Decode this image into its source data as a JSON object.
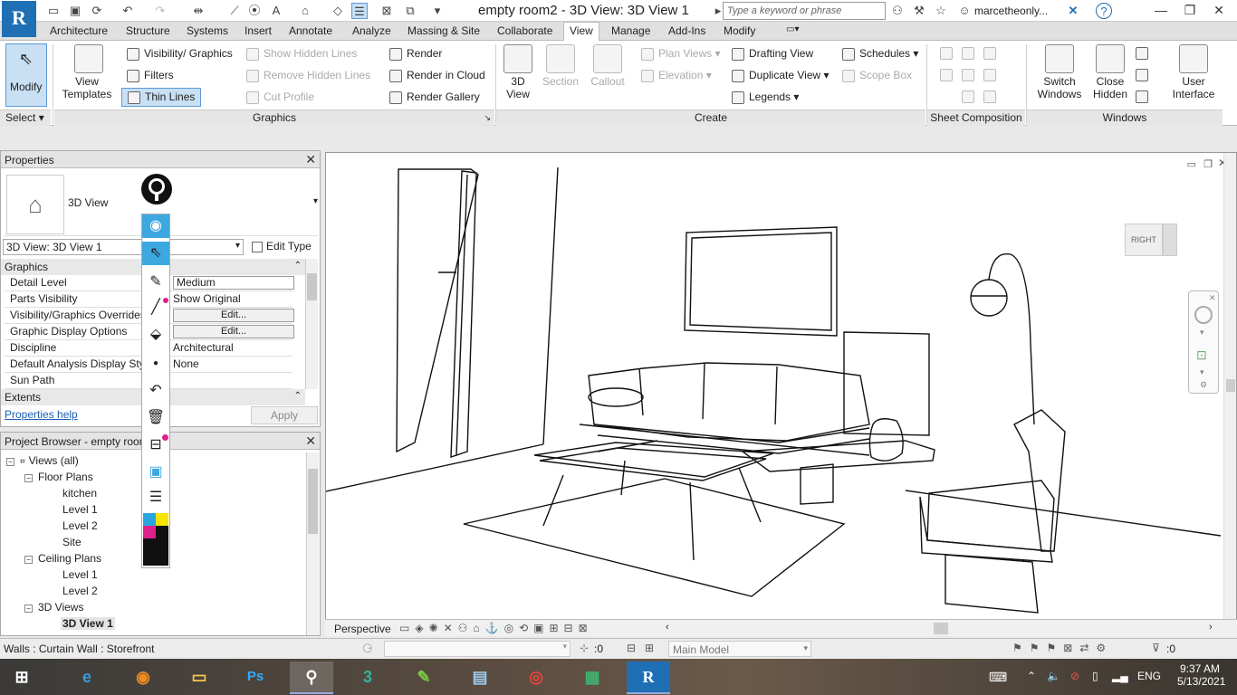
{
  "titlebar": {
    "app_letter": "R",
    "window_title": "empty room2 - 3D View: 3D View 1",
    "search_placeholder": "Type a keyword or phrase",
    "user_name": "marcetheonly...",
    "help_icon": "?"
  },
  "tabs": [
    {
      "label": "Architecture"
    },
    {
      "label": "Structure"
    },
    {
      "label": "Systems"
    },
    {
      "label": "Insert"
    },
    {
      "label": "Annotate"
    },
    {
      "label": "Analyze"
    },
    {
      "label": "Massing & Site"
    },
    {
      "label": "Collaborate"
    },
    {
      "label": "View"
    },
    {
      "label": "Manage"
    },
    {
      "label": "Add-Ins"
    },
    {
      "label": "Modify"
    }
  ],
  "ribbon": {
    "modify_label": "Modify",
    "select_label": "Select",
    "view_templates_label": "View Templates",
    "visibility_graphics": "Visibility/ Graphics",
    "filters": "Filters",
    "thin_lines": "Thin Lines",
    "show_hidden_lines": "Show Hidden Lines",
    "remove_hidden_lines": "Remove Hidden Lines",
    "cut_profile": "Cut Profile",
    "render": "Render",
    "render_in_cloud": "Render in Cloud",
    "render_gallery": "Render Gallery",
    "graphics_panel": "Graphics",
    "view_3d": "3D View",
    "section": "Section",
    "callout": "Callout",
    "plan_views": "Plan Views",
    "elevation": "Elevation",
    "drafting_view": "Drafting View",
    "duplicate_view": "Duplicate View",
    "legends": "Legends",
    "schedules": "Schedules",
    "scope_box": "Scope Box",
    "create_panel": "Create",
    "sheet_composition_panel": "Sheet Composition",
    "switch_windows": "Switch Windows",
    "close_hidden": "Close Hidden",
    "user_interface": "User Interface",
    "windows_panel": "Windows"
  },
  "properties": {
    "title": "Properties",
    "type_name": "3D View",
    "instance_selector": "3D View: 3D View 1",
    "edit_type": "Edit Type",
    "groups": {
      "graphics": "Graphics",
      "extents": "Extents"
    },
    "rows": [
      {
        "label": "Detail Level",
        "value": "Medium"
      },
      {
        "label": "Parts Visibility",
        "value": "Show Original"
      },
      {
        "label": "Visibility/Graphics Overrides",
        "value": "Edit..."
      },
      {
        "label": "Graphic Display Options",
        "value": "Edit..."
      },
      {
        "label": "Discipline",
        "value": "Architectural"
      },
      {
        "label": "Default Analysis Display Style",
        "value": "None"
      },
      {
        "label": "Sun Path",
        "value": ""
      }
    ],
    "help_link": "Properties help",
    "apply": "Apply"
  },
  "browser": {
    "title": "Project Browser - empty room2",
    "root": "Views (all)",
    "floor_plans": "Floor Plans",
    "floor_items": [
      "kitchen",
      "Level 1",
      "Level 2",
      "Site"
    ],
    "ceiling_plans": "Ceiling Plans",
    "ceiling_items": [
      "Level 1",
      "Level 2"
    ],
    "views_3d": "3D Views",
    "views_3d_items": [
      "3D View 1"
    ]
  },
  "viewport": {
    "viewcube_face": "RIGHT",
    "view_mode": "Perspective"
  },
  "statusbar": {
    "message": "Walls : Curtain Wall : Storefront",
    "selection_count": ":0",
    "workset": "Main Model",
    "filter_count": ":0"
  },
  "taskbar": {
    "apps": [
      "Internet Explorer",
      "Firefox",
      "File Explorer",
      "Photoshop",
      "Screen Marker",
      "3ds Max",
      "Sketch",
      "Notepad",
      "Chrome",
      "Calculator",
      "Revit"
    ],
    "language": "ENG",
    "time": "9:37 AM",
    "date": "5/13/2021"
  }
}
